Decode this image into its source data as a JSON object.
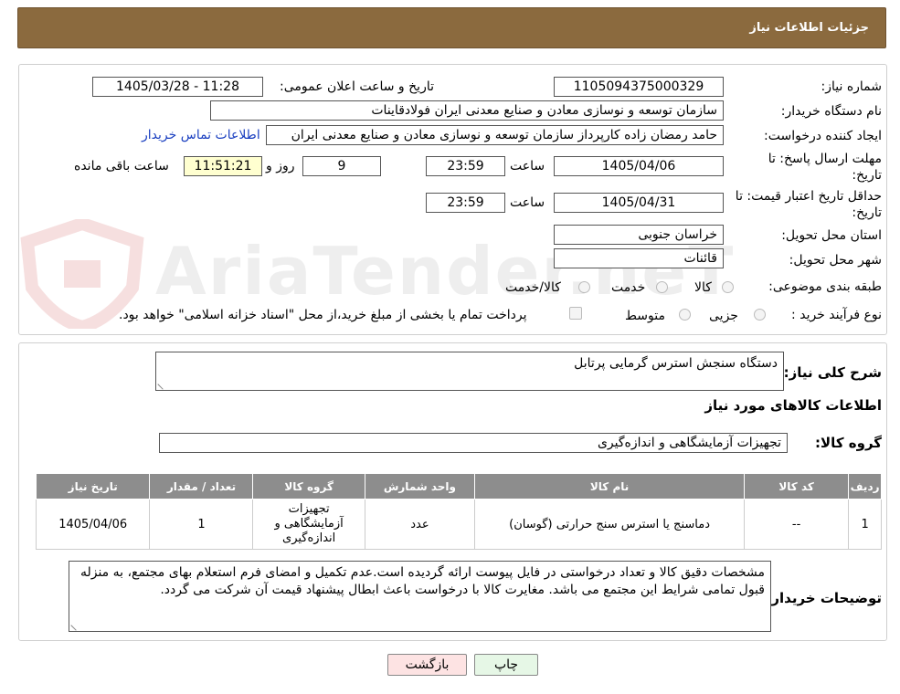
{
  "header": {
    "title": "جزئیات اطلاعات نیاز"
  },
  "watermark": {
    "text": "AriaTender.neT"
  },
  "form": {
    "need_number_label": "شماره نیاز:",
    "need_number": "1105094375000329",
    "announce_label": "تاریخ و ساعت اعلان عمومی:",
    "announce_value": "1405/03/28 - 11:28",
    "buyer_label": "نام دستگاه خریدار:",
    "buyer_value": "سازمان توسعه و نوسازی معادن و صنایع معدنی ایران فولادقاینات",
    "creator_label": "ایجاد کننده درخواست:",
    "creator_value": "حامد  رمضان زاده  کارپرداز  سازمان توسعه و نوسازی معادن و صنایع معدنی ایران",
    "contact_link": "اطلاعات تماس خریدار",
    "deadline_label_1": "مهلت ارسال پاسخ: تا",
    "deadline_label_2": "تاریخ:",
    "deadline_date": "1405/04/06",
    "time_label": "ساعت",
    "deadline_time": "23:59",
    "days_value": "9",
    "days_label": "روز و",
    "remaining_time": "11:51:21",
    "remaining_label": "ساعت باقی مانده",
    "validity_label_1": "حداقل تاریخ اعتبار قیمت: تا",
    "validity_label_2": "تاریخ:",
    "validity_date": "1405/04/31",
    "validity_time": "23:59",
    "province_label": "استان محل تحویل:",
    "province_value": "خراسان جنوبی",
    "city_label": "شهر محل تحویل:",
    "city_value": "قائنات",
    "category_label": "طبقه بندی موضوعی:",
    "category_options": [
      "کالا",
      "خدمت",
      "کالا/خدمت"
    ],
    "process_label": "نوع فرآیند خرید :",
    "process_options": [
      "جزیی",
      "متوسط"
    ],
    "payment_note": "پرداخت تمام یا بخشی از مبلغ خرید،از محل \"اسناد خزانه اسلامی\" خواهد بود."
  },
  "details": {
    "summary_label": "شرح کلی نیاز:",
    "summary_value": "دستگاه سنجش استرس گرمایی پرتابل",
    "goods_info_title": "اطلاعات کالاهای مورد نیاز",
    "group_label": "گروه کالا:",
    "group_value": "تجهیزات آزمایشگاهی و اندازه‌گیری",
    "table": {
      "headers": [
        "ردیف",
        "کد کالا",
        "نام کالا",
        "واحد شمارش",
        "گروه کالا",
        "تعداد / مقدار",
        "تاریخ نیاز"
      ],
      "rows": [
        [
          "1",
          "--",
          "دماسنج یا استرس سنج حرارتی (گوسان)",
          "عدد",
          "تجهیزات آزمایشگاهی و اندازه‌گیری",
          "1",
          "1405/04/06"
        ]
      ]
    },
    "buyer_notes_label": "توضیحات خریدار:",
    "buyer_notes": "مشخصات دقیق کالا و تعداد درخواستی در فایل پیوست ارائه گردیده است.عدم تکمیل و امضای فرم استعلام بهای مجتمع، به منزله قبول تمامی شرایط این مجتمع می باشد. مغایرت کالا با درخواست باعث ابطال پیشنهاد قیمت آن شرکت می گردد."
  },
  "buttons": {
    "print": "چاپ",
    "back": "بازگشت"
  },
  "colors": {
    "header": "#8b6a3e",
    "print_button": "#e6f7e6",
    "back_button": "#fde3e3",
    "table_header": "#8d8d8d"
  }
}
